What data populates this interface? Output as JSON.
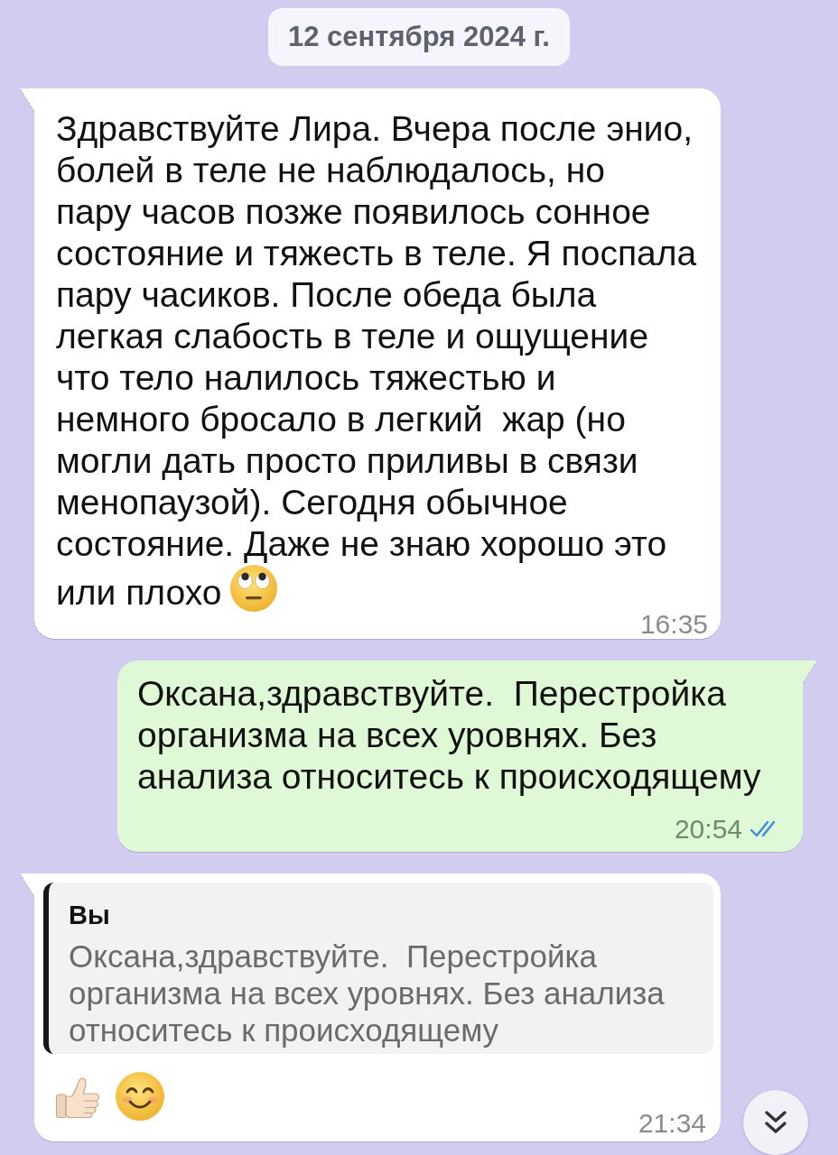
{
  "date_label": "12 сентября 2024 г.",
  "messages": [
    {
      "kind": "incoming",
      "text": "Здравствуйте Лира. Вчера после энио,\nболей в теле не наблюдалось, но\nпару часов позже появилось сонное\nсостояние и тяжесть в теле. Я поспала\nпару часиков. После обеда была\nлегкая слабость в теле и ощущение\nчто тело налилось тяжестью и\nнемного бросало в легкий  жар (но\nмогли дать просто приливы в связи\nменопаузой). Сегодня обычное\nсостояние. Даже не знаю хорошо это\nили плохо",
      "emojis": [
        {
          "kind": "eye-roll"
        }
      ],
      "time": "16:35"
    },
    {
      "kind": "outgoing",
      "text": "Оксана,здравствуйте.  Перестройка организма на всех уровнях. Без анализа относитесь к происходящему",
      "time": "20:54",
      "read": true
    },
    {
      "kind": "incoming",
      "reply_to": {
        "author": "Вы",
        "text": "Оксана,здравствуйте.  Перестройка организма на всех уровнях. Без анализа относитесь к происходящему"
      },
      "emojis": [
        {
          "kind": "thumbs-up"
        },
        {
          "kind": "smile"
        }
      ],
      "time": "21:34"
    }
  ]
}
